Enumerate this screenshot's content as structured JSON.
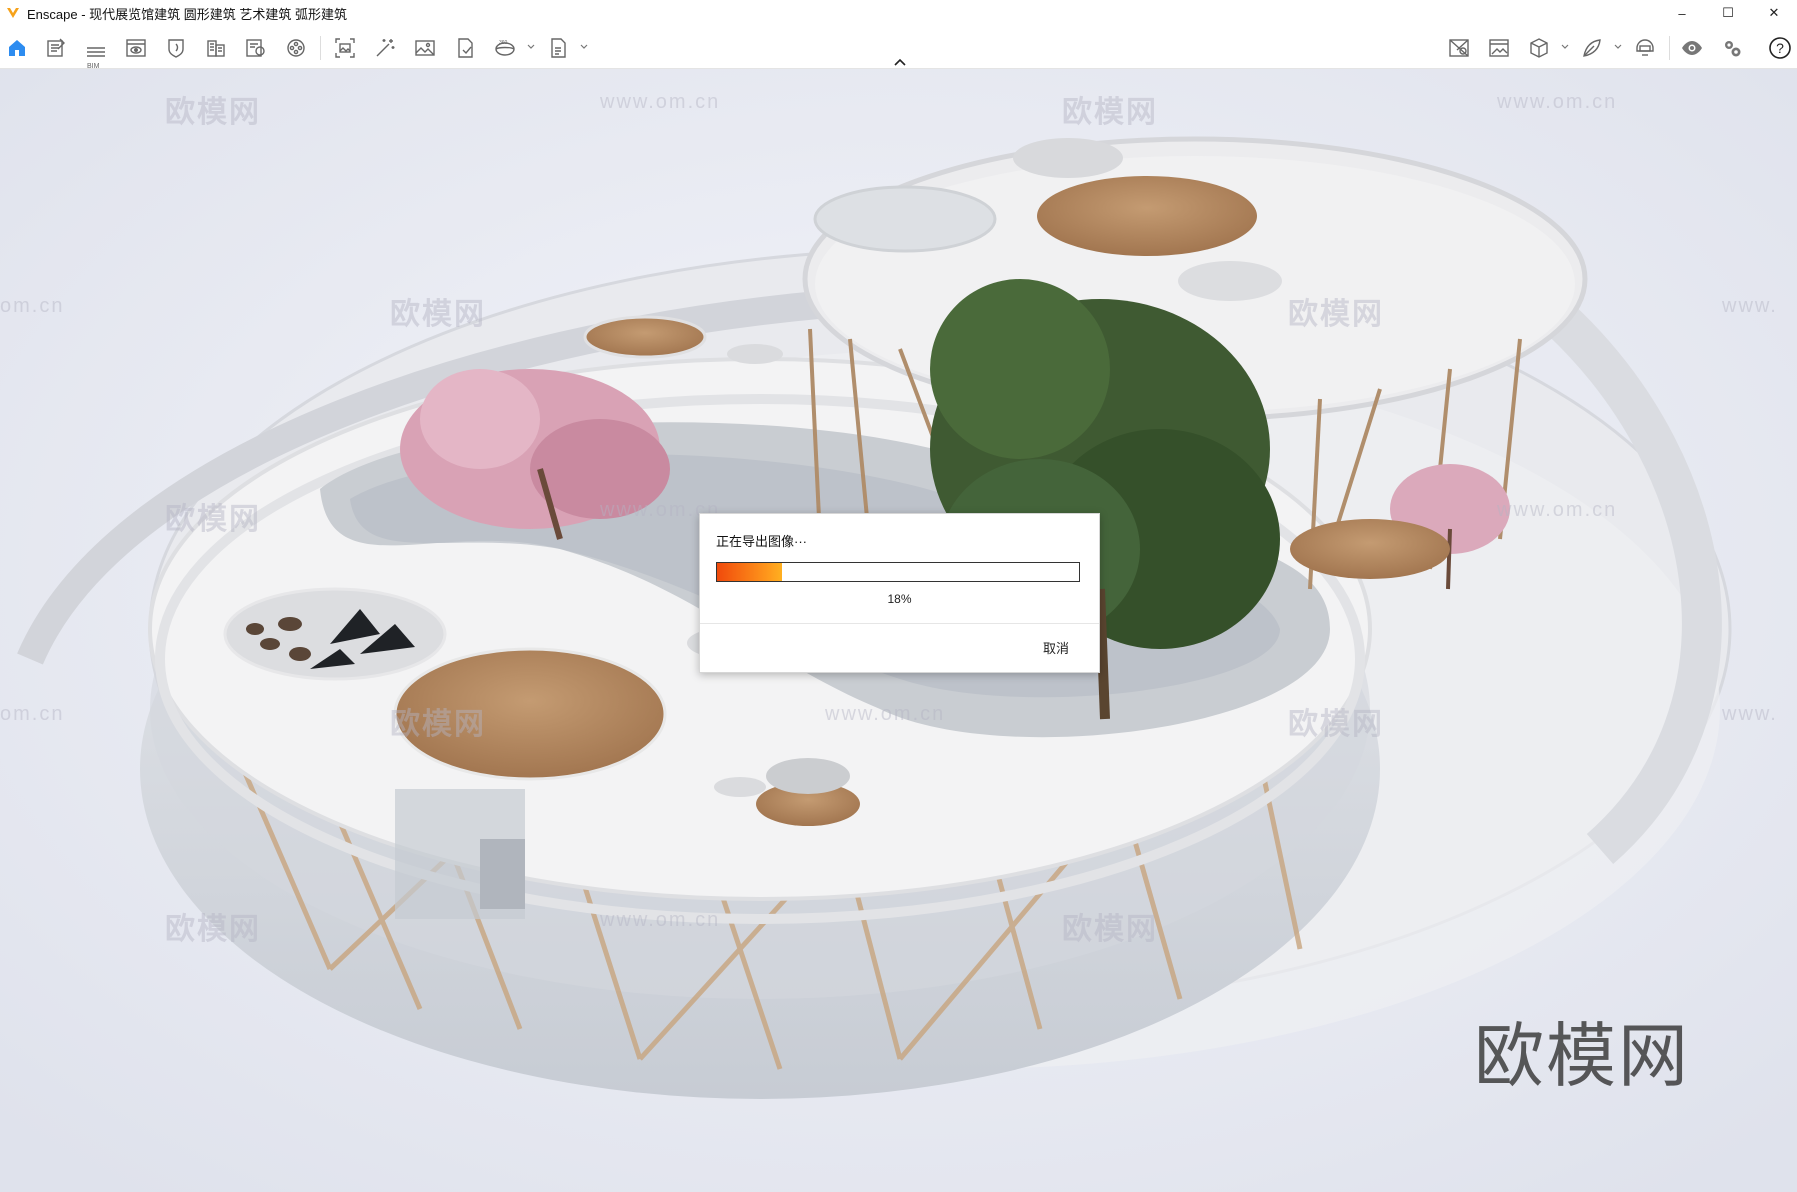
{
  "window": {
    "title": "Enscape - 现代展览馆建筑 圆形建筑 艺术建筑 弧形建筑",
    "controls": {
      "minimize": "–",
      "maximize": "☐",
      "close": "✕"
    }
  },
  "toolbar": {
    "left_icons": [
      "home-icon",
      "assets-icon",
      "bim-icon",
      "view-icon",
      "atmosphere-icon",
      "building-icon",
      "material-icon",
      "video-icon",
      "screenshot-icon",
      "magic-wand-icon",
      "image-icon",
      "export-icon",
      "panorama-360-icon",
      "exe-export-icon"
    ],
    "bim_label": "BIM",
    "right_icons": [
      "render-gallery-icon",
      "visual-settings-icon",
      "cube-view-icon",
      "feather-icon",
      "vr-headset-icon",
      "eye-icon",
      "settings-icon",
      "help-icon"
    ],
    "help_symbol": "?",
    "accent_color": "#2d8cf0"
  },
  "watermarks": {
    "brand": "欧模网",
    "url": "www.om.cn",
    "url_short": "om.cn",
    "url_prefix": "www."
  },
  "dialog": {
    "title": "正在导出图像···",
    "progress": 0.18,
    "progress_label": "18%",
    "cancel_label": "取消"
  }
}
